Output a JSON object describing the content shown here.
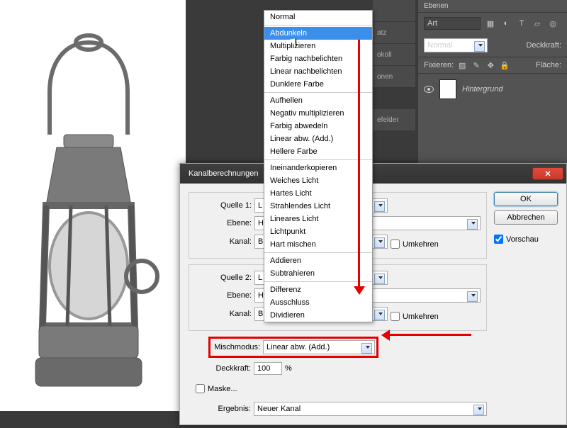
{
  "panels": {
    "header": "Ebenen",
    "search_value": "Art",
    "blend_label": "Normal",
    "opacity_label": "Deckkraft:",
    "fix_label": "Fixieren:",
    "fill_label": "Fläche:",
    "layer_name": "Hintergrund"
  },
  "side_tabs": [
    "",
    "atz",
    "okoll",
    "onen",
    "efelder"
  ],
  "dialog": {
    "title": "Kanalberechnungen",
    "ok": "OK",
    "cancel": "Abbrechen",
    "preview": "Vorschau",
    "source1_label": "Quelle 1:",
    "source2_label": "Quelle 2:",
    "ebene_label": "Ebene:",
    "kanal_label": "Kanal:",
    "invert": "Umkehren",
    "src_val": "L",
    "ebene_val": "Hi",
    "kanal_val": "Bla",
    "mix_label": "Mischmodus:",
    "mix_value": "Linear abw. (Add.)",
    "opacity_label": "Deckkraft:",
    "opacity_value": "100",
    "percent": "%",
    "mask": "Maske...",
    "result_label": "Ergebnis:",
    "result_value": "Neuer Kanal"
  },
  "menu": {
    "groups": [
      [
        "Normal"
      ],
      [
        "Abdunkeln",
        "Multiplizieren",
        "Farbig nachbelichten",
        "Linear nachbelichten",
        "Dunklere Farbe"
      ],
      [
        "Aufhellen",
        "Negativ multiplizieren",
        "Farbig abwedeln",
        "Linear abw. (Add.)",
        "Hellere Farbe"
      ],
      [
        "Ineinanderkopieren",
        "Weiches Licht",
        "Hartes Licht",
        "Strahlendes Licht",
        "Lineares Licht",
        "Lichtpunkt",
        "Hart mischen"
      ],
      [
        "Addieren",
        "Subtrahieren"
      ],
      [
        "Differenz",
        "Ausschluss",
        "Dividieren"
      ]
    ],
    "selected": "Abdunkeln"
  }
}
